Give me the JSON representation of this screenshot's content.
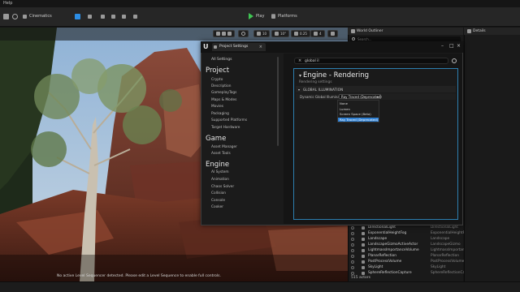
{
  "menu": {
    "help": "Help"
  },
  "toolbar": {
    "cinematics_label": "Cinematics",
    "play_label": "Play",
    "platforms_label": "Platforms",
    "vp_values": [
      "10",
      "10°",
      "0.25",
      "4"
    ]
  },
  "viewport": {
    "sequencer_message": "No active Level Sequencer detected. Please edit a Level Sequence to enable full controls."
  },
  "outliner": {
    "title": "World Outliner",
    "search_placeholder": "Search...",
    "rows": [
      {
        "name": "DirectionalLight",
        "type": "DirectionalLight"
      },
      {
        "name": "ExponentialHeightFog",
        "type": "ExponentialHeightFog"
      },
      {
        "name": "Landscape",
        "type": "Landscape"
      },
      {
        "name": "LandscapeGizmoActiveActor",
        "type": "LandscapeGizmo"
      },
      {
        "name": "LightmassImportanceVolume",
        "type": "LightmassImportance"
      },
      {
        "name": "PlanarReflection",
        "type": "PlanarReflection"
      },
      {
        "name": "PostProcessVolume",
        "type": "PostProcessVolume"
      },
      {
        "name": "SkyLight",
        "type": "SkyLight"
      },
      {
        "name": "SphereReflectionCapture",
        "type": "SphereReflectionCapture"
      }
    ],
    "actor_count": "515 actors"
  },
  "details": {
    "title": "Details"
  },
  "project_settings": {
    "tab_label": "Project Settings",
    "all_settings": "All Settings",
    "sections": [
      {
        "title": "Project",
        "items": [
          "Crypto",
          "Description",
          "GameplayTags",
          "Maps & Modes",
          "Movies",
          "Packaging",
          "Supported Platforms",
          "Target Hardware"
        ]
      },
      {
        "title": "Game",
        "items": [
          "Asset Manager",
          "Asset Tools"
        ]
      },
      {
        "title": "Engine",
        "items": [
          "AI System",
          "Animation",
          "Chaos Solver",
          "Collision",
          "Console",
          "Cooker"
        ]
      }
    ],
    "search_value": "global il",
    "panel_title": "Engine - Rendering",
    "panel_subtitle": "Rendering settings",
    "category": "GLOBAL ILLUMINATION",
    "property_label": "Dynamic Global Illuminatio",
    "property_value": "Ray Traced (Deprecated)",
    "options": [
      "None",
      "Lumen",
      "Screen Space (Beta)",
      "Ray Traced (Deprecated)"
    ],
    "selected_option_index": 3
  },
  "colors": {
    "accent": "#2f7fd1",
    "play_green": "#3fc553",
    "panel_border": "#2d7fb0"
  }
}
